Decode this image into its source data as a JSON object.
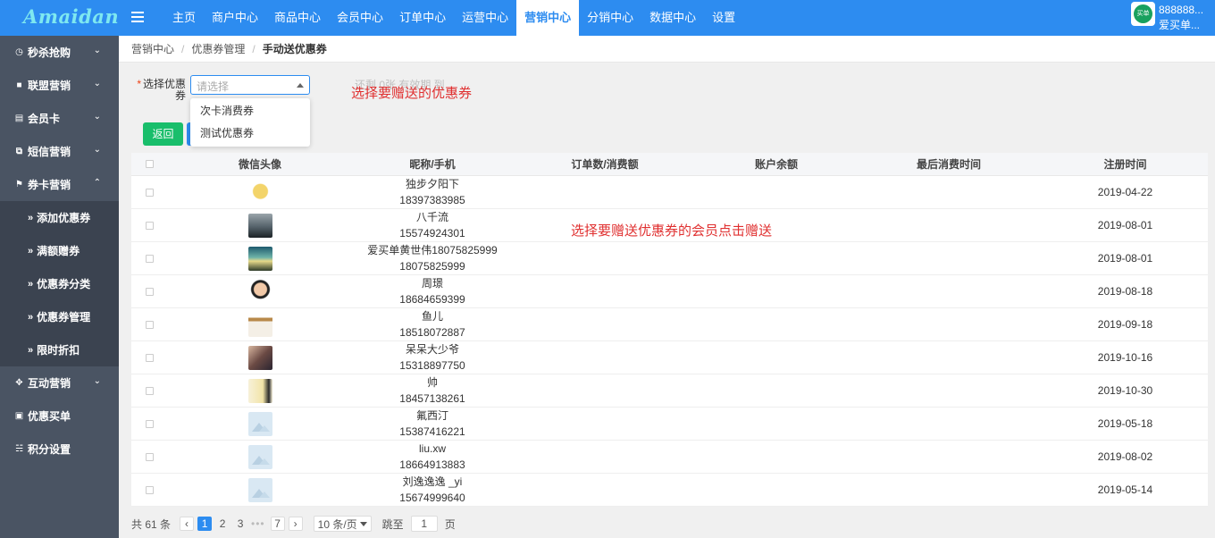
{
  "header": {
    "logo": "Amaidan",
    "nav": [
      {
        "label": "主页",
        "active": false
      },
      {
        "label": "商户中心",
        "active": false
      },
      {
        "label": "商品中心",
        "active": false
      },
      {
        "label": "会员中心",
        "active": false
      },
      {
        "label": "订单中心",
        "active": false
      },
      {
        "label": "运营中心",
        "active": false
      },
      {
        "label": "营销中心",
        "active": true
      },
      {
        "label": "分销中心",
        "active": false
      },
      {
        "label": "数据中心",
        "active": false
      },
      {
        "label": "设置",
        "active": false
      }
    ],
    "user_line1": "888888...",
    "user_line2": "爱买单...",
    "avatar_text": "买单"
  },
  "sidebar": {
    "items": [
      {
        "label": "秒杀抢购",
        "icon": "clock-icon",
        "chevron": "down"
      },
      {
        "label": "联盟营销",
        "icon": "gift-icon",
        "chevron": "down"
      },
      {
        "label": "会员卡",
        "icon": "card-icon",
        "chevron": "down"
      },
      {
        "label": "短信营销",
        "icon": "clone-icon",
        "chevron": "down"
      },
      {
        "label": "券卡营销",
        "icon": "tag-icon",
        "chevron": "up"
      }
    ],
    "subitems": [
      {
        "label": "添加优惠券"
      },
      {
        "label": "满额赠券"
      },
      {
        "label": "优惠券分类"
      },
      {
        "label": "优惠券管理"
      },
      {
        "label": "限时折扣"
      }
    ],
    "items_after": [
      {
        "label": "互动营销",
        "icon": "expand-icon",
        "chevron": "down"
      },
      {
        "label": "优惠买单",
        "icon": "briefcase-icon",
        "chevron": ""
      },
      {
        "label": "积分设置",
        "icon": "database-icon",
        "chevron": ""
      }
    ]
  },
  "breadcrumb": [
    "营销中心",
    "优惠券管理",
    "手动送优惠券"
  ],
  "form": {
    "label": "选择优惠券",
    "placeholder": "请选择",
    "hint": "还剩 0张 有效期 到",
    "annotation": "选择要赠送的优惠券",
    "options": [
      "次卡消费券",
      "测试优惠券"
    ],
    "back_button": "返回"
  },
  "table": {
    "headers": [
      "微信头像",
      "昵称/手机",
      "订单数/消费额",
      "账户余额",
      "最后消费时间",
      "注册时间"
    ],
    "rows": [
      {
        "name": "独步夕阳下",
        "phone": "18397383985",
        "reg": "2019-04-22",
        "avatar": "cartoon-yellow"
      },
      {
        "name": "八千流",
        "phone": "15574924301",
        "reg": "2019-08-01",
        "avatar": "silhouette"
      },
      {
        "name": "爱买单黄世伟18075825999",
        "phone": "18075825999",
        "reg": "2019-08-01",
        "avatar": "landscape"
      },
      {
        "name": "周璟",
        "phone": "18684659399",
        "reg": "2019-08-18",
        "avatar": "cartoon-boy"
      },
      {
        "name": "鱼儿",
        "phone": "18518072887",
        "reg": "2019-09-18",
        "avatar": "document"
      },
      {
        "name": "呆呆大少爷",
        "phone": "15318897750",
        "reg": "2019-10-16",
        "avatar": "portrait"
      },
      {
        "name": "帅",
        "phone": "18457138261",
        "reg": "2019-10-30",
        "avatar": "warm"
      },
      {
        "name": "氟西汀",
        "phone": "15387416221",
        "reg": "2019-05-18",
        "avatar": "placeholder"
      },
      {
        "name": "liu.xw",
        "phone": "18664913883",
        "reg": "2019-08-02",
        "avatar": "placeholder"
      },
      {
        "name": "刘逸逸逸 _yi",
        "phone": "15674999640",
        "reg": "2019-05-14",
        "avatar": "placeholder"
      }
    ],
    "annotation": "选择要赠送优惠券的会员点击赠送"
  },
  "pagination": {
    "total": "共 61 条",
    "pages": [
      "1",
      "2",
      "3",
      "7"
    ],
    "current": "1",
    "page_size": "10 条/页",
    "jump_label": "跳至",
    "jump_value": "1",
    "page_suffix": "页"
  },
  "colors": {
    "primary": "#2d8cf0",
    "success": "#19be6b",
    "sidebar": "#4a5463",
    "annotation": "#e03030"
  }
}
